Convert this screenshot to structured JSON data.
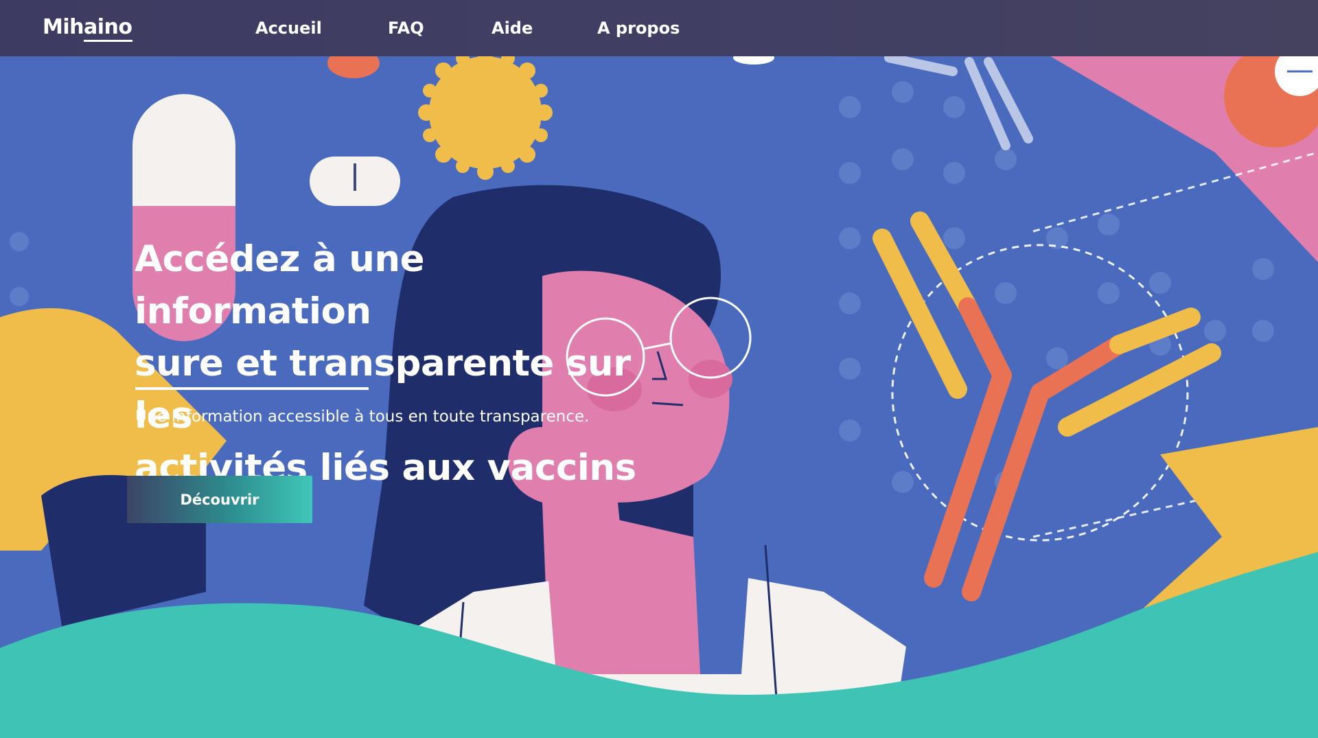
{
  "brand": {
    "name_prefix": "Mih",
    "name_underlined": "aino"
  },
  "nav": {
    "items": [
      {
        "label": "Accueil"
      },
      {
        "label": "FAQ"
      },
      {
        "label": "Aide"
      },
      {
        "label": "A propos"
      }
    ]
  },
  "hero": {
    "headline_line1": "Accédez à une information",
    "headline_line2": "sure et transparente sur les",
    "headline_line3": "activités liés aux vaccins",
    "subtitle": "Une information accessible à tous en toute transparence.",
    "cta_label": "Découvrir"
  },
  "colors": {
    "navbar": "#3d3b61",
    "hero_blue": "#4a6bbd",
    "dark_navy": "#1f2d6b",
    "accent_yellow": "#f0bd4a",
    "accent_pink": "#e07fae",
    "accent_coral": "#ea7254",
    "accent_teal": "#3ec3b4",
    "text_white": "#ffffff"
  }
}
